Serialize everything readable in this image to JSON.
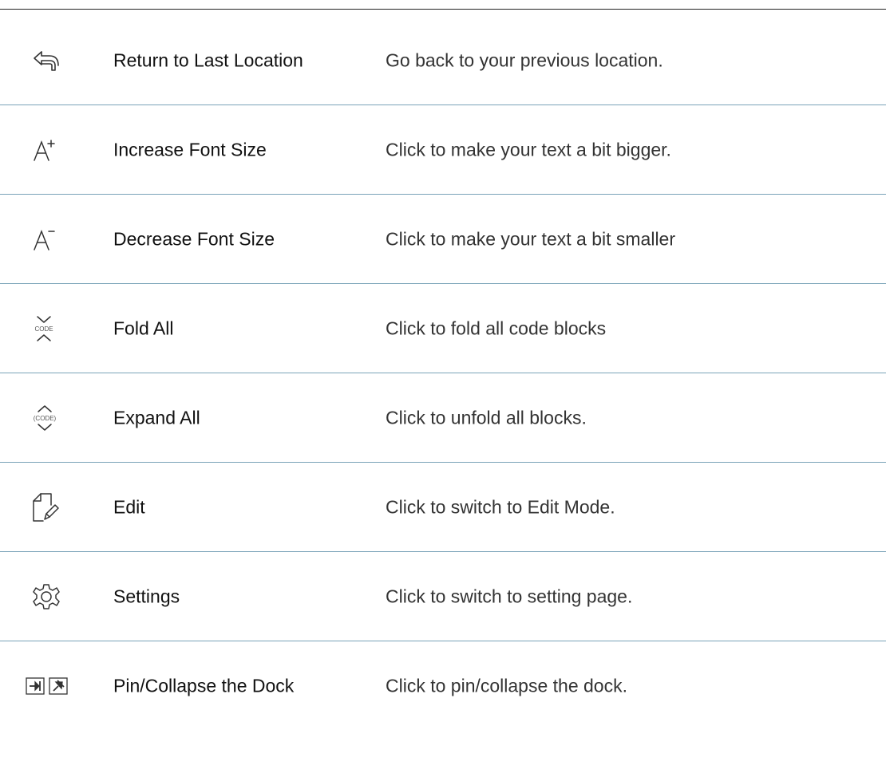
{
  "rows": [
    {
      "icon": "return-arrow-icon",
      "name": "Return to Last Location",
      "desc": "Go back to your previous location."
    },
    {
      "icon": "font-increase-icon",
      "name": "Increase Font Size",
      "desc": "Click to make your text a bit bigger."
    },
    {
      "icon": "font-decrease-icon",
      "name": "Decrease Font Size",
      "desc": "Click to make your text a bit smaller"
    },
    {
      "icon": "fold-code-icon",
      "name": "Fold All",
      "desc": "Click to fold all code blocks",
      "icon_text": "CODE"
    },
    {
      "icon": "expand-code-icon",
      "name": "Expand All",
      "desc": "Click to unfold all blocks.",
      "icon_text": "(CODE)"
    },
    {
      "icon": "edit-document-icon",
      "name": "Edit",
      "desc": "Click to switch to Edit Mode."
    },
    {
      "icon": "settings-gear-icon",
      "name": "Settings",
      "desc": "Click to switch to setting page."
    },
    {
      "icon": "pin-dock-icon",
      "name": "Pin/Collapse the Dock",
      "desc": "Click to pin/collapse the dock."
    }
  ],
  "colors": {
    "separator": "#7aa3b8",
    "text": "#222222",
    "icon": "#333333"
  }
}
